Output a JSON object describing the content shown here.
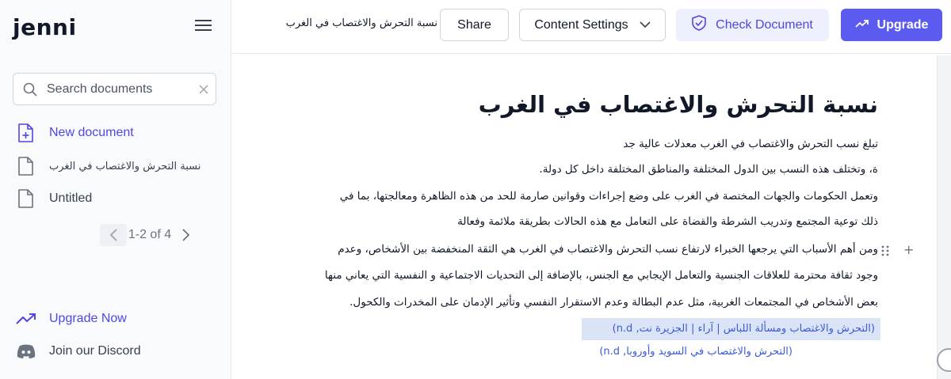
{
  "app": {
    "logo": "jenni"
  },
  "sidebar": {
    "search_placeholder": "Search documents",
    "items": [
      {
        "label": "New document",
        "icon": "new-document-icon"
      },
      {
        "label": "نسبة التحرش والاغتصاب في الغرب",
        "icon": "document-icon"
      },
      {
        "label": "Untitled",
        "icon": "document-icon"
      }
    ],
    "pager": {
      "text": "1-2 of 4"
    },
    "upgrade_label": "Upgrade Now",
    "discord_label": "Join our Discord"
  },
  "header": {
    "doc_title": "نسبة التحرش والاغتصاب في الغرب",
    "share_label": "Share",
    "content_settings_label": "Content Settings",
    "check_label": "Check Document",
    "upgrade_label": "Upgrade"
  },
  "document": {
    "heading": "نسبة التحرش والاغتصاب في الغرب",
    "lines": [
      "تبلغ نسب التحرش والاغتصاب في الغرب معدلات عالية جد",
      "ة، وتختلف هذه النسب بين الدول المختلفة والمناطق المختلفة داخل كل دولة.",
      "وتعمل الحكومات والجهات المختصة في الغرب على وضع إجراءات وقوانين صارمة للحد من هذه الظاهرة ومعالجتها، بما في",
      "ذلك توعية المجتمع وتدريب الشرطة والقضاة على التعامل مع هذه الحالات بطريقة ملائمة وفعالة",
      "ومن أهم الأسباب التي يرجعها الخبراء لارتفاع نسب التحرش والاغتصاب في الغرب هي الثقة المنخفضة بين الأشخاص، وعدم",
      "وجود ثقافة محترمة للعلاقات الجنسية والتعامل الإيجابي مع الجنس، بالإضافة إلى التحديات الاجتماعية و النفسية التي يعاني منها",
      "بعض الأشخاص في المجتمعات الغربية، مثل عدم البطالة وعدم الاستقرار النفسي وتأثير الإدمان على المخدرات والكحول."
    ],
    "citation_1": "(التحرش والاغتصاب ومسألة اللباس | آراء | الجزيرة نت, n.d)",
    "citation_2": "(التحرش والاغتصاب في السويد وأوروبا, n.d)"
  },
  "colors": {
    "accent": "#4f46e5",
    "upgrade_bg": "#5b5bf0",
    "check_bg": "#eef0fd",
    "citation_highlight": "#dbe4f6"
  }
}
